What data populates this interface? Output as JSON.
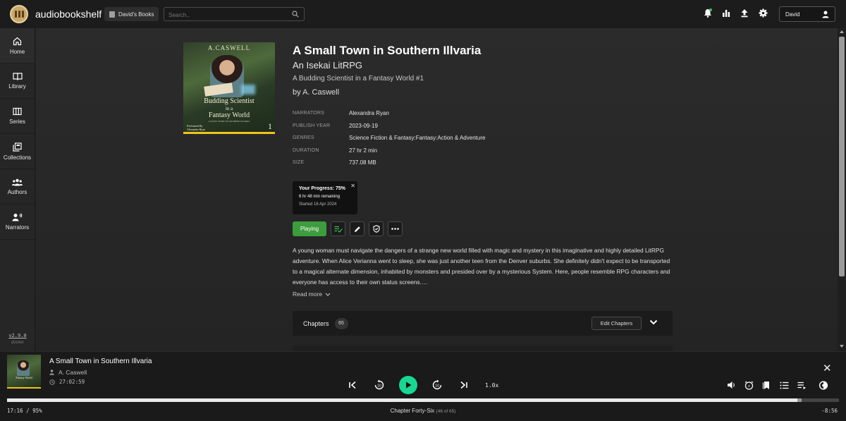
{
  "header": {
    "app_title": "audiobookshelf",
    "library_button": "David's Books",
    "search_placeholder": "Search..",
    "user_name": "David",
    "icons": [
      "notification-bell-icon",
      "stats-icon",
      "upload-icon",
      "settings-gear-icon",
      "user-icon"
    ]
  },
  "sidebar": {
    "items": [
      {
        "label": "Home",
        "icon": "home-icon"
      },
      {
        "label": "Library",
        "icon": "library-icon"
      },
      {
        "label": "Series",
        "icon": "series-icon"
      },
      {
        "label": "Collections",
        "icon": "collections-icon"
      },
      {
        "label": "Authors",
        "icon": "authors-icon"
      },
      {
        "label": "Narrators",
        "icon": "narrators-icon"
      }
    ],
    "version": "v2.9.0",
    "version_sub": "docker"
  },
  "book": {
    "title": "A Small Town in Southern Illvaria",
    "subtitle": "An Isekai LitRPG",
    "series": "A Budding Scientist in a Fantasy World #1",
    "byline": "by A. Caswell",
    "cover": {
      "author": "A.CASWELL",
      "line1": "Budding Scientist",
      "line2": "in a",
      "line3": "Fantasy World",
      "tagline": "A NOVEL STORY OF SOUTHERN ILLVARIA",
      "narrator_line1": "Performed By",
      "narrator_line2": "Alexandra Ryan",
      "number": "1"
    },
    "details": [
      {
        "label": "NARRATORS",
        "value": "Alexandra Ryan"
      },
      {
        "label": "PUBLISH YEAR",
        "value": "2023-09-19"
      },
      {
        "label": "GENRES",
        "value": "Science Fiction & Fantasy:Fantasy:Action & Adventure"
      },
      {
        "label": "DURATION",
        "value": "27 hr 2 min"
      },
      {
        "label": "SIZE",
        "value": "737.08 MB"
      }
    ],
    "progress": {
      "title": "Your Progress: 75%",
      "remaining": "6 hr 48 min remaining",
      "started": "Started 16 Apr 2024",
      "close": "✕"
    },
    "actions": {
      "playing_label": "Playing",
      "icons": [
        "mark-finished-icon",
        "edit-icon",
        "collection-shield-icon",
        "more-icon"
      ]
    },
    "description": "A young woman must navigate the dangers of a strange new world filled with magic and mystery in this imaginative and highly detailed LitRPG adventure. When Alice Verianna went to sleep, she was just another teen from the Denver suburbs. She definitely didn't expect to be transported to a magical alternate dimension, inhabited by monsters and presided over by a mysterious System. Here, people resemble RPG characters and everyone has access to their own status screens.…",
    "read_more": "Read more",
    "chapters": {
      "label": "Chapters",
      "count": "65",
      "edit_label": "Edit Chapters"
    }
  },
  "player": {
    "title": "A Small Town in Southern Illvaria",
    "author": "A. Caswell",
    "duration": "27:02:59",
    "speed": "1.0x",
    "elapsed": "17:16 / 95%",
    "chapter": "Chapter Forty-Six",
    "chapter_of": "(46 of 65)",
    "remaining": "-8:56",
    "progress_fraction": 0.95,
    "buffer_fraction": 0.005,
    "accent_color": "#1ad691"
  }
}
